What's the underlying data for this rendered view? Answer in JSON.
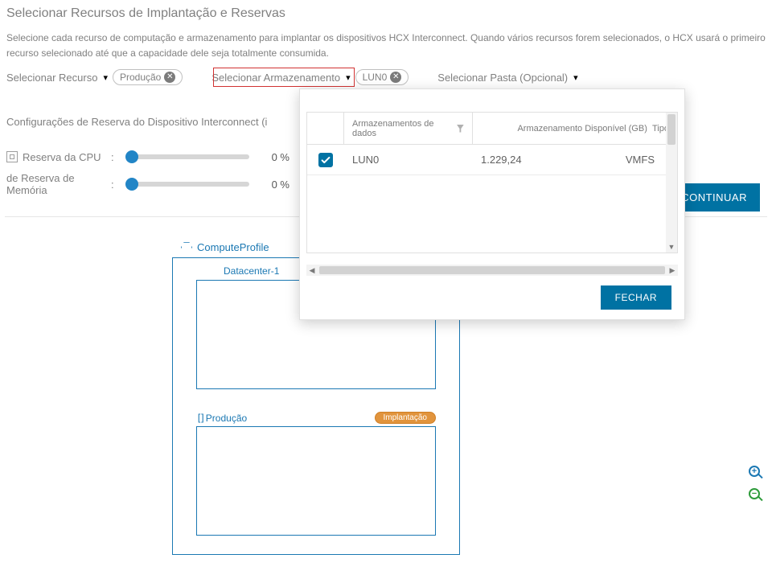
{
  "title": "Selecionar Recursos de Implantação e Reservas",
  "description": "Selecione cada recurso de computação e armazenamento para implantar os dispositivos HCX Interconnect. Quando vários recursos forem selecionados, o HCX usará o primeiro recurso selecionado até que a capacidade dele seja totalmente consumida.",
  "selectors": {
    "resource": {
      "label": "Selecionar Recurso",
      "chip": "Produção"
    },
    "storage": {
      "label": "Selecionar Armazenamento",
      "chip": "LUN0"
    },
    "folder": {
      "label": "Selecionar Pasta (Opcional)"
    }
  },
  "reservation": {
    "section_title": "Configurações de Reserva do Dispositivo Interconnect (i",
    "cpu_label": "Reserva da CPU",
    "mem_label": "de Reserva de Memória",
    "cpu_pct": "0 %",
    "mem_pct": "0 %"
  },
  "buttons": {
    "continue": "CONTINUAR",
    "close": "FECHAR"
  },
  "diagram": {
    "profile": "ComputeProfile",
    "datacenter": "Datacenter-1",
    "cluster": "Produção",
    "cluster_tag": "Implantação"
  },
  "popover": {
    "cols": {
      "name": "Armazenamentos de dados",
      "avail": "Armazenamento Disponível (GB)",
      "type": "Tipo"
    },
    "rows": [
      {
        "name": "LUN0",
        "avail": "1.229,24",
        "type": "VMFS",
        "checked": true
      }
    ]
  }
}
